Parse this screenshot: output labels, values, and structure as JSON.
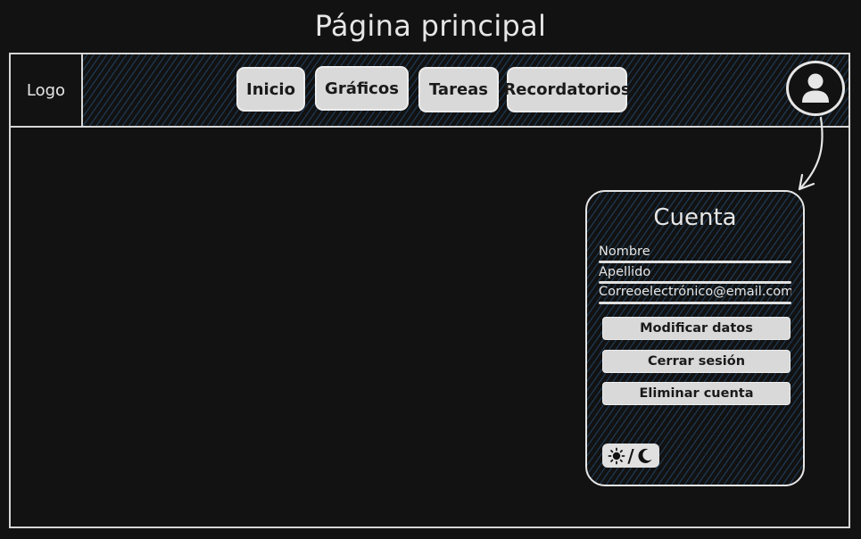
{
  "page": {
    "title": "Página principal"
  },
  "header": {
    "logo_label": "Logo",
    "nav_items": [
      {
        "label": "Inicio"
      },
      {
        "label": "Gráficos"
      },
      {
        "label": "Tareas"
      },
      {
        "label": "Recordatorios"
      }
    ],
    "avatar_icon": "user-icon"
  },
  "account_panel": {
    "title": "Cuenta",
    "fields": [
      {
        "value": "Nombre"
      },
      {
        "value": "Apellido"
      },
      {
        "value": "Correoelectrónico@email.com"
      }
    ],
    "buttons": [
      {
        "label": "Modificar datos"
      },
      {
        "label": "Cerrar sesión"
      },
      {
        "label": "Eliminar cuenta"
      }
    ],
    "theme_toggle_icons": [
      "sun-icon",
      "moon-icon"
    ],
    "theme_toggle_separator": "/"
  },
  "colors": {
    "background": "#121212",
    "hatch": "#285a8c",
    "button_fill": "#d9d9d9",
    "stroke": "#e6e6e6"
  }
}
